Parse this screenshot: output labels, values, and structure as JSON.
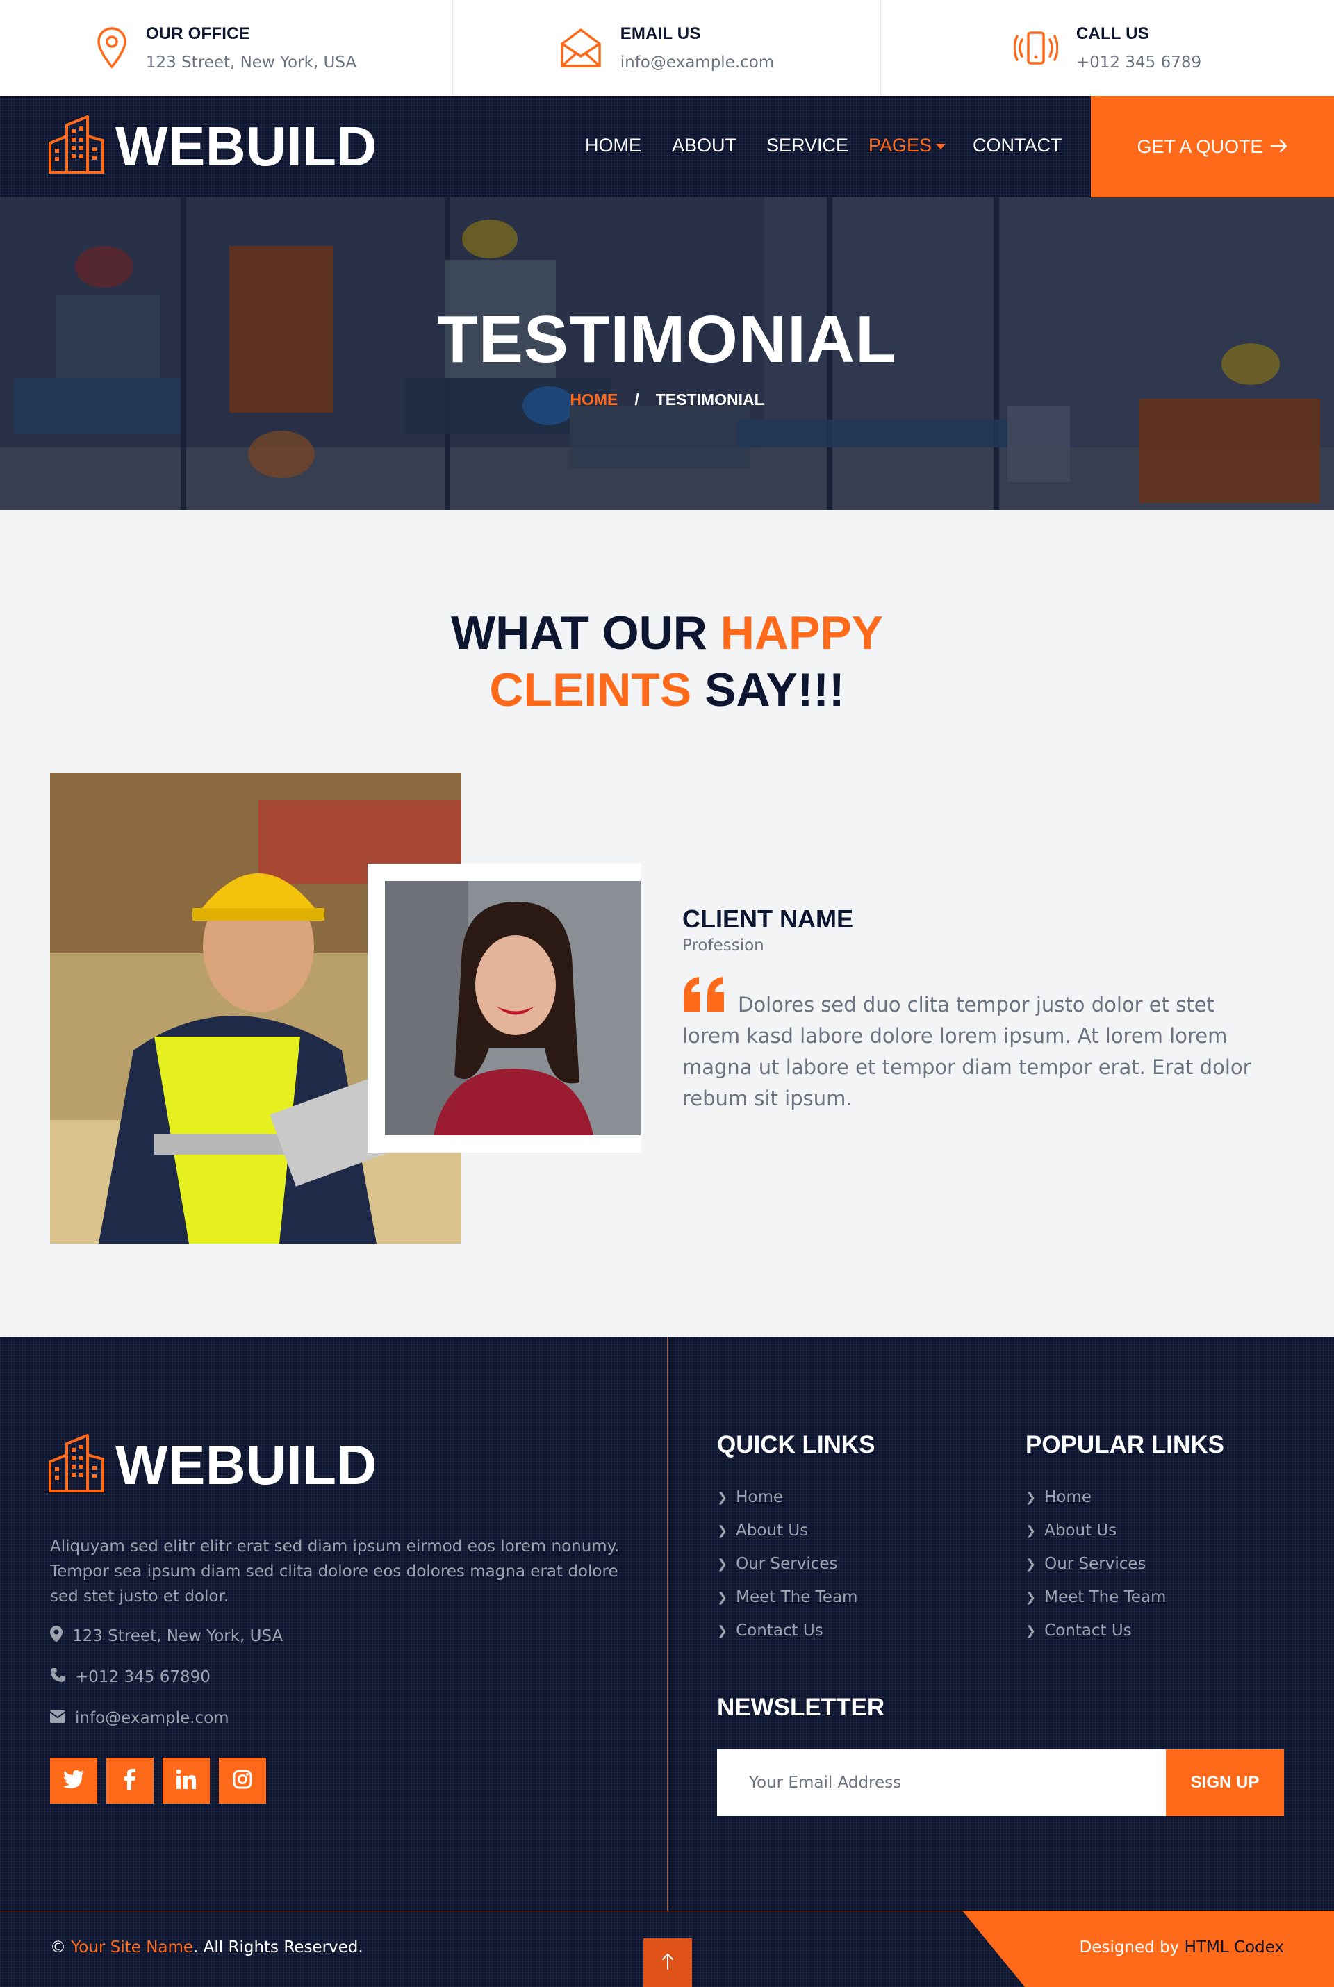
{
  "topbar": {
    "office": {
      "label": "OUR OFFICE",
      "value": "123 Street, New York, USA",
      "icon": "map-pin-icon"
    },
    "email": {
      "label": "EMAIL US",
      "value": "info@example.com",
      "icon": "envelope-icon"
    },
    "call": {
      "label": "CALL US",
      "value": "+012 345 6789",
      "icon": "phone-ringing-icon"
    }
  },
  "brand": {
    "name": "WEBUILD",
    "icon": "building-icon"
  },
  "nav": {
    "items": [
      "HOME",
      "ABOUT",
      "SERVICE",
      "PAGES",
      "CONTACT"
    ],
    "active": "PAGES",
    "cta": "GET A QUOTE"
  },
  "hero": {
    "title": "TESTIMONIAL",
    "breadcrumb": {
      "home": "HOME",
      "separator": "/",
      "current": "TESTIMONIAL"
    }
  },
  "section": {
    "title_part1": "WHAT OUR ",
    "title_hl1": "HAPPY",
    "title_hl2": "CLEINTS",
    "title_part2": " SAY!!!"
  },
  "testimonial": {
    "name": "CLIENT NAME",
    "profession": "Profession",
    "quote": "Dolores sed duo clita tempor justo dolor et stet lorem kasd labore dolore lorem ipsum. At lorem lorem magna ut labore et tempor diam tempor erat. Erat dolor rebum sit ipsum."
  },
  "footer": {
    "brand": "WEBUILD",
    "about": "Aliquyam sed elitr elitr erat sed diam ipsum eirmod eos lorem nonumy. Tempor sea ipsum diam sed clita dolore eos dolores magna erat dolore sed stet justo et dolor.",
    "address": "123 Street, New York, USA",
    "phone": "+012 345 67890",
    "email": "info@example.com",
    "social": [
      "twitter-icon",
      "facebook-icon",
      "linkedin-icon",
      "instagram-icon"
    ],
    "quick_links": {
      "title": "QUICK LINKS",
      "items": [
        "Home",
        "About Us",
        "Our Services",
        "Meet The Team",
        "Contact Us"
      ]
    },
    "popular_links": {
      "title": "POPULAR LINKS",
      "items": [
        "Home",
        "About Us",
        "Our Services",
        "Meet The Team",
        "Contact Us"
      ]
    },
    "newsletter": {
      "title": "NEWSLETTER",
      "placeholder": "Your Email Address",
      "button": "SIGN UP"
    },
    "copyright": {
      "prefix": "©",
      "site": "Your Site Name",
      "suffix": ". All Rights Reserved."
    },
    "designed": {
      "prefix": "Designed by",
      "by": "HTML Codex"
    }
  },
  "colors": {
    "accent": "#ff6a1a",
    "navy": "#0d1530",
    "muted": "#6b7280",
    "bg": "#f3f4f6"
  }
}
